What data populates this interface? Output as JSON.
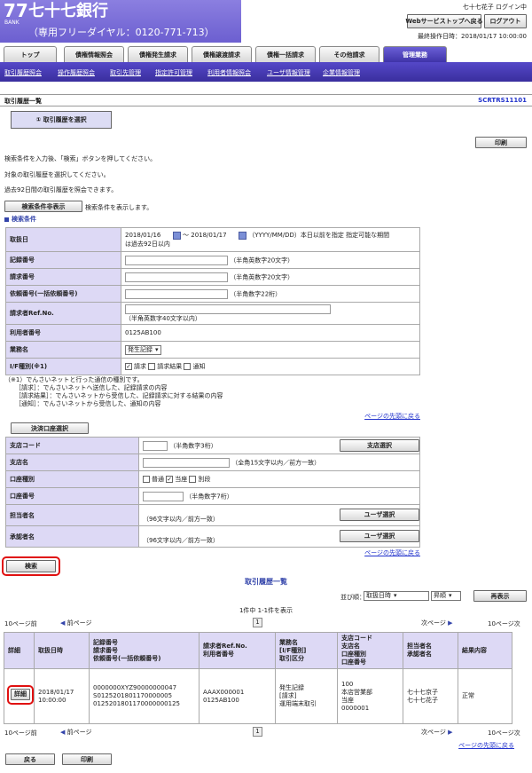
{
  "header": {
    "logo_num": "77",
    "logo_bank": "BANK",
    "bank_name": "七十七銀行",
    "free_dial": "（専用フリーダイヤル：0120-771-713）",
    "login_status": "七十七花子 ログイン中",
    "web_service_stop_label": "Webサービストップへ戻る",
    "logout_label": "ログアウト",
    "last_operation": "最終操作日時：2018/01/17 10:00:00"
  },
  "tabs": [
    {
      "label": "トップ"
    },
    {
      "label": "債権情報照会"
    },
    {
      "label": "債権発生請求"
    },
    {
      "label": "債権譲渡請求"
    },
    {
      "label": "債権一括請求"
    },
    {
      "label": "その他請求"
    },
    {
      "label": "管理業務"
    }
  ],
  "subnav": [
    "取引履歴照会",
    "操作履歴照会",
    "取引先管理",
    "指定許可管理",
    "利用者情報照会",
    "ユーザ情報管理",
    "企業情報管理"
  ],
  "page": {
    "title": "取引履歴一覧",
    "screen_id": "SCRTRS11101",
    "step_label": "① 取引履歴を選択",
    "print_label": "印刷",
    "instructions": [
      "検索条件を入力後、「検索」ボタンを押してください。",
      "対象の取引履歴を選択してください。",
      "過去92日間の取引履歴を照会できます。"
    ],
    "toggle_label": "検索条件非表示",
    "toggle_note": "検索条件を表示します。",
    "search_heading": "検索条件"
  },
  "search": {
    "date_label": "取扱日",
    "date_from": "2018/01/16",
    "date_to": "2018/01/17",
    "date_tilde": "〜",
    "date_note_1": "（YYYY/MM/DD）本日以前を指定 指定可能な期間",
    "date_note_2": "は過去92日以内",
    "record_no_label": "記録番号",
    "record_no_hint": "（半角英数字20文字）",
    "request_no_label": "請求番号",
    "request_no_hint": "（半角英数字20文字）",
    "batch_no_label": "依頼番号(一括依頼番号)",
    "batch_no_hint": "（半角数字22桁）",
    "ref_label": "請求者Ref.No.",
    "ref_hint": "（半角英数字40文字以内）",
    "user_no_label": "利用者番号",
    "user_no_value": "0125AB100",
    "business_label": "業務名",
    "business_value": "発生記録",
    "if_label": "I/F種別(※1)",
    "if_options": [
      "請求",
      "請求結果",
      "通知"
    ],
    "notes": [
      "（※1）でんさいネットと行った通信の種別です。",
      "［請求］：でんさいネットへ送信した、記録請求の内容",
      "［請求結果］：でんさいネットから受信した、記録請求に対する結果の内容",
      "［通知］：でんさいネットから受信した、通知の内容"
    ],
    "page_top_link": "ページの先頭に戻る"
  },
  "account": {
    "select_label": "決済口座選択",
    "branch_code_label": "支店コード",
    "branch_code_hint": "（半角数字3桁）",
    "branch_select_label": "支店選択",
    "branch_name_label": "支店名",
    "branch_name_hint": "（全角15文字以内／前方一致）",
    "type_label": "口座種別",
    "type_options": [
      "普通",
      "当座",
      "別段"
    ],
    "number_label": "口座番号",
    "number_hint": "（半角数字7桁）",
    "staff_label": "担当者名",
    "staff_hint": "（96文字以内／前方一致）",
    "user_select_label": "ユーザ選択",
    "approver_label": "承認者名",
    "approver_hint": "（96文字以内／前方一致）",
    "page_top_link": "ページの先頭に戻る"
  },
  "search_button_label": "検索",
  "results": {
    "heading": "取引履歴一覧",
    "sort_label": "並び順：",
    "sort_field": "取扱日時",
    "sort_order": "昇順",
    "redisplay_label": "再表示",
    "count_text": "1件中 1-1件を表示",
    "prev10": "10ページ前",
    "prev": "前ページ",
    "next": "次ページ",
    "next10": "10ページ次",
    "page_num": "1",
    "columns": [
      "詳細",
      "取扱日時",
      "記録番号\n請求番号\n依頼番号(一括依頼番号)",
      "請求者Ref.No.\n利用者番号",
      "業務名\n[I/F種別]\n取引区分",
      "支店コード\n支店名\n口座種別\n口座番号",
      "担当者名\n承認者名",
      "結果内容"
    ],
    "row": {
      "detail_label": "詳細",
      "datetime": "2018/01/17\n10:00:00",
      "numbers": "0000000XYZ90000000047\nS0125201801170000005\n0125201801170000000125",
      "ref": "AAAX000001\n0125AB100",
      "business": "発生記録\n[請求]\n運用端末取引",
      "branch": "100\n本店営業部\n当座\n0000001",
      "persons": "七十七京子\n七十七花子",
      "result": "正常"
    },
    "page_top_link": "ページの先頭に戻る"
  },
  "footer": {
    "back_label": "戻る",
    "print_label": "印刷"
  }
}
